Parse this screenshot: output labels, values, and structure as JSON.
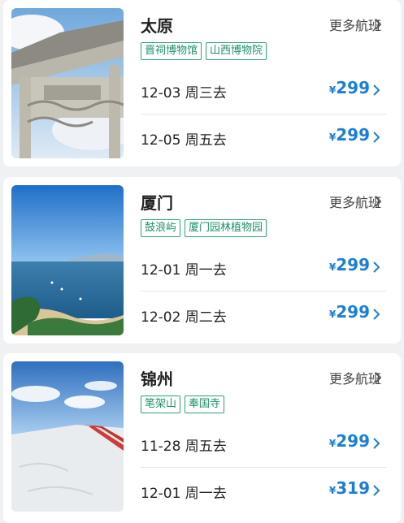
{
  "colors": {
    "accent_price": "#1a7fd6",
    "tag_border": "#2aa37a"
  },
  "cards": [
    {
      "city": "太原",
      "more_label": "更多航班",
      "tags": [
        "晋祠博物馆",
        "山西博物院"
      ],
      "flights": [
        {
          "date": "12-03 周三去",
          "currency": "¥",
          "price": "299"
        },
        {
          "date": "12-05 周五去",
          "currency": "¥",
          "price": "299"
        }
      ]
    },
    {
      "city": "厦门",
      "more_label": "更多航班",
      "tags": [
        "鼓浪屿",
        "厦门园林植物园"
      ],
      "flights": [
        {
          "date": "12-01 周一去",
          "currency": "¥",
          "price": "299"
        },
        {
          "date": "12-02 周二去",
          "currency": "¥",
          "price": "299"
        }
      ]
    },
    {
      "city": "锦州",
      "more_label": "更多航班",
      "tags": [
        "笔架山",
        "奉国寺"
      ],
      "flights": [
        {
          "date": "11-28 周五去",
          "currency": "¥",
          "price": "299"
        },
        {
          "date": "12-01 周一去",
          "currency": "¥",
          "price": "319"
        }
      ]
    }
  ]
}
